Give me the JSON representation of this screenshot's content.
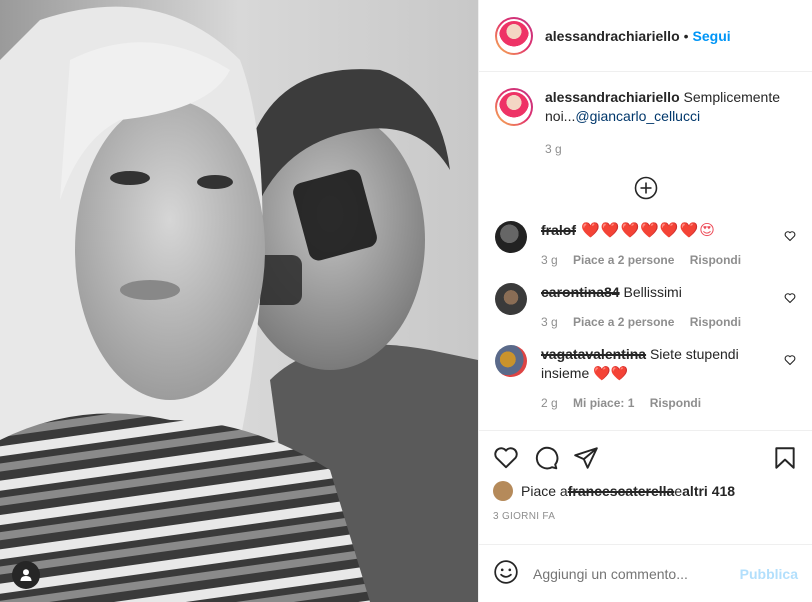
{
  "post": {
    "username": "alessandrachiariello",
    "dot": "•",
    "follow_label": "Segui",
    "caption_text": "Semplicemente noi...",
    "caption_mention": "@giancarlo_cellucci",
    "caption_time": "3 g"
  },
  "comments": [
    {
      "user": "fralof",
      "text": " ❤️❤️❤️❤️❤️❤️😍",
      "time": "3 g",
      "likes": "Piace a 2 persone",
      "reply": "Rispondi"
    },
    {
      "user": "carontina84",
      "text": " Bellissimi",
      "time": "3 g",
      "likes": "Piace a 2 persone",
      "reply": "Rispondi"
    },
    {
      "user": "vagatavalentina",
      "text": " Siete stupendi insieme ❤️❤️",
      "time": "2 g",
      "likes": "Mi piace: 1",
      "reply": "Rispondi"
    }
  ],
  "likes_bar": {
    "prefix": "Piace a ",
    "user": "francescaterella",
    "middle": " e ",
    "others": "altri 418"
  },
  "posted_ago": "3 GIORNI FA",
  "add_comment": {
    "placeholder": "Aggiungi un commento...",
    "publish_label": "Pubblica"
  },
  "icons": {
    "like": "heart-icon",
    "comment": "comment-icon",
    "share": "send-icon",
    "save": "bookmark-icon",
    "emoji": "smiley-icon",
    "load_more": "plus-circle-icon",
    "user_tag": "person-icon"
  },
  "colors": {
    "accent": "#0095f6",
    "publish_disabled": "#b2dffc",
    "secondary_text": "#8e8e8e",
    "heart": "#ed4956"
  }
}
